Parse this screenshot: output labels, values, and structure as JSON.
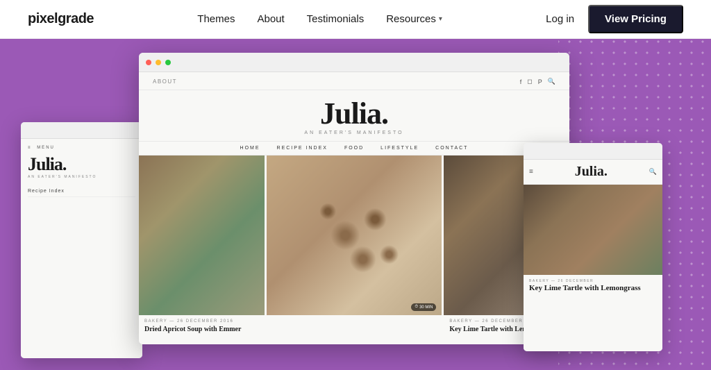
{
  "header": {
    "logo": "pixelgrade",
    "nav": {
      "themes_label": "Themes",
      "about_label": "About",
      "testimonials_label": "Testimonials",
      "resources_label": "Resources"
    },
    "login_label": "Log in",
    "pricing_label": "View Pricing"
  },
  "julia_theme": {
    "about_label": "ABOUT",
    "title": "Julia.",
    "subtitle": "AN EATER'S MANIFESTO",
    "nav_items": [
      "HOME",
      "RECIPE INDEX",
      "FOOD",
      "LIFESTYLE",
      "CONTACT"
    ],
    "post1": {
      "category": "BAKERY — 26 DECEMBER 2016",
      "title": "Dried Apricot Soup with Emmer"
    },
    "post2": {
      "category": "BAKERY — 26 DECEMBER",
      "title": "Key Lime Tartle with Lemongrass"
    },
    "timer1": "30 MIN",
    "timer2": "30 MIN"
  },
  "small_browser_left": {
    "menu_label": "MENU",
    "title": "Julia.",
    "subtitle": "AN EATER'S MANIFESTO",
    "nav_items": [
      "Recipe Index"
    ]
  },
  "small_browser_right": {
    "title": "Julia.",
    "search_icon": "🔍",
    "post_category": "BAKERY — 26 DECEMBER",
    "post_title": "Key Lime Tartle with Lemongrass"
  },
  "icons": {
    "facebook": "f",
    "instagram": "◻",
    "pinterest": "p",
    "search": "🔍",
    "clock": "⏱",
    "chevron_down": "▾",
    "hamburger": "≡"
  }
}
